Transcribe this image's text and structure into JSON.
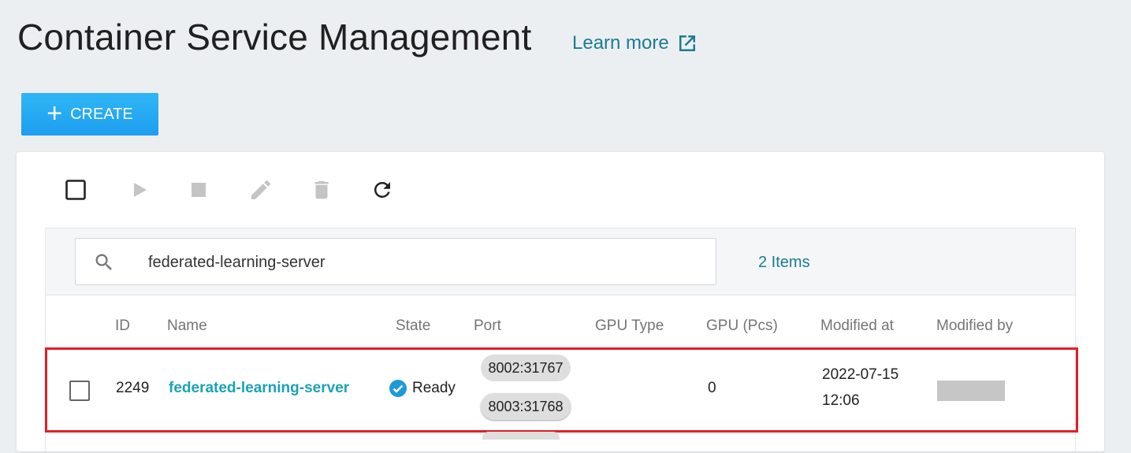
{
  "page": {
    "title": "Container Service Management",
    "learn_more": "Learn more"
  },
  "actions": {
    "create_label": "CREATE"
  },
  "toolbar": {
    "icons": [
      "select-all-checkbox",
      "play-icon",
      "stop-icon",
      "edit-icon",
      "delete-icon",
      "refresh-icon"
    ]
  },
  "search": {
    "value": "federated-learning-server",
    "items_count": "2 Items"
  },
  "table": {
    "columns": [
      "ID",
      "Name",
      "State",
      "Port",
      "GPU Type",
      "GPU (Pcs)",
      "Modified at",
      "Modified by"
    ],
    "rows": [
      {
        "id": "2249",
        "name": "federated-learning-server",
        "state": "Ready",
        "ports": [
          "8002:31767",
          "8003:31768"
        ],
        "gpu_type": "",
        "gpu_pcs": "0",
        "modified_date": "2022-07-15",
        "modified_time": "12:06"
      }
    ]
  },
  "colors": {
    "accent": "#1b7c93",
    "link": "#1aa3b5",
    "create_button": "#1e9ef0",
    "highlight": "#e21f26"
  }
}
